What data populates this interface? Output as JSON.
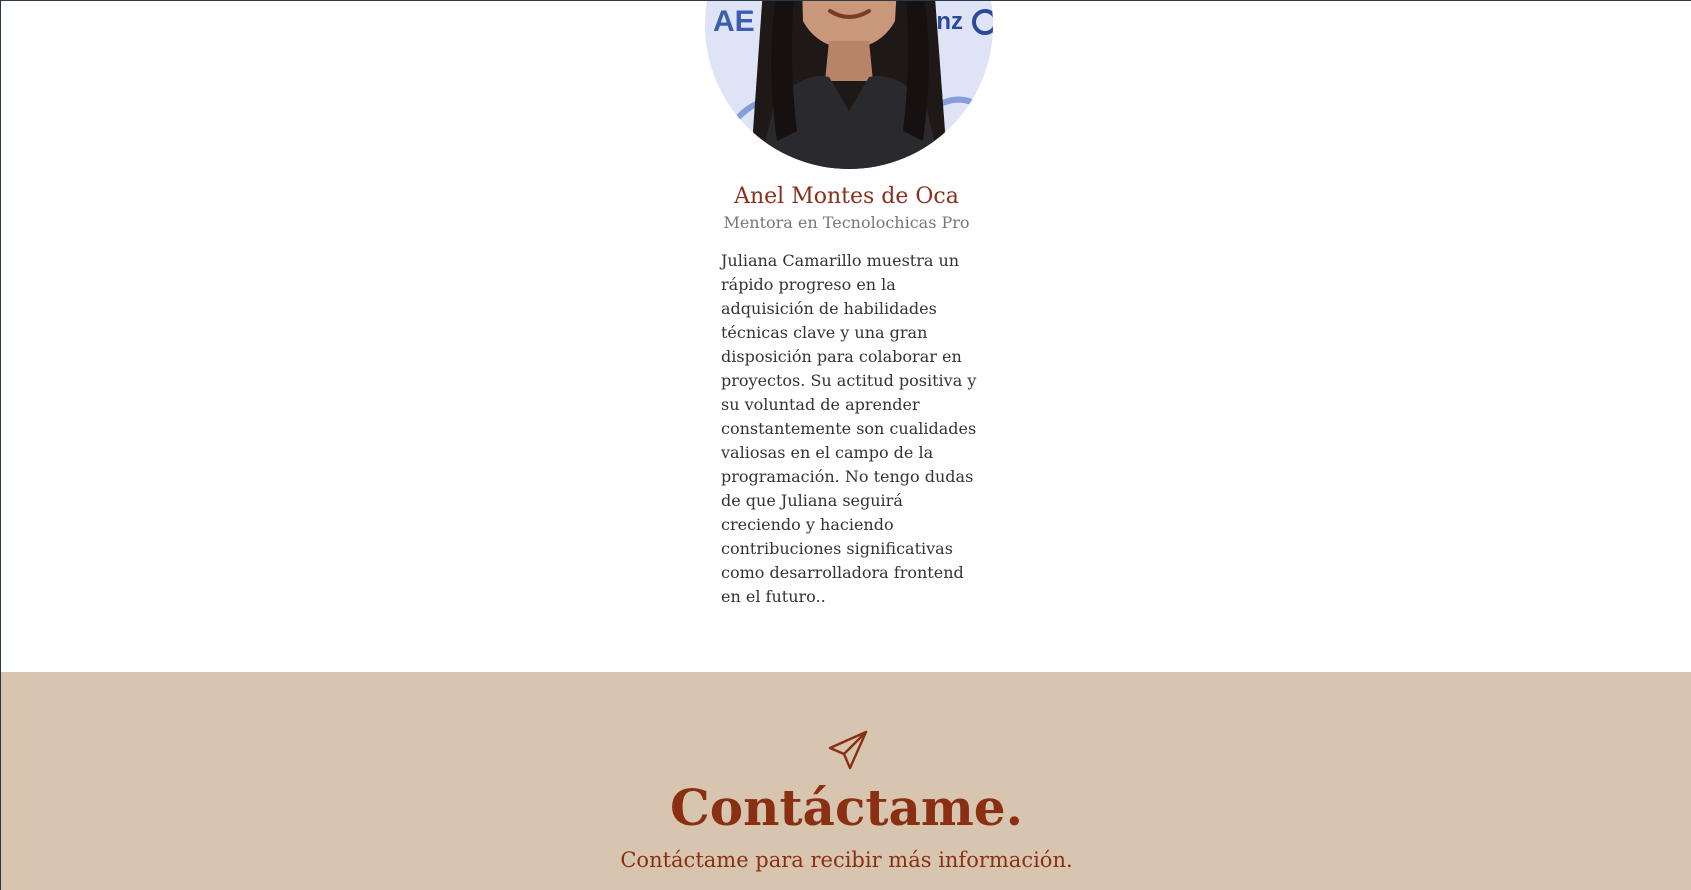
{
  "testimonial": {
    "photo_alt": "Foto de Anel Montes de Oca",
    "backdrop_text_left": "AE",
    "backdrop_text_right": "llianz",
    "name": "Anel Montes de Oca",
    "role": "Mentora en Tecnolochicas Pro",
    "quote": "Juliana Camarillo muestra un rápido progreso en la adquisición de habilidades técnicas clave y una gran disposición para colaborar en proyectos. Su actitud positiva y su voluntad de aprender constantemente son cualidades valiosas en el campo de la programación. No tengo dudas de que Juliana seguirá creciendo y haciendo contribuciones significativas como desarrolladora frontend en el futuro.."
  },
  "contact": {
    "icon": "paper-plane-icon",
    "title": "Contáctame.",
    "subtitle": "Contáctame para recibir más información."
  },
  "colors": {
    "accent": "#8a2f12",
    "contact_background": "#d8c5b0",
    "role_text": "#777777",
    "body_text": "#333333"
  }
}
